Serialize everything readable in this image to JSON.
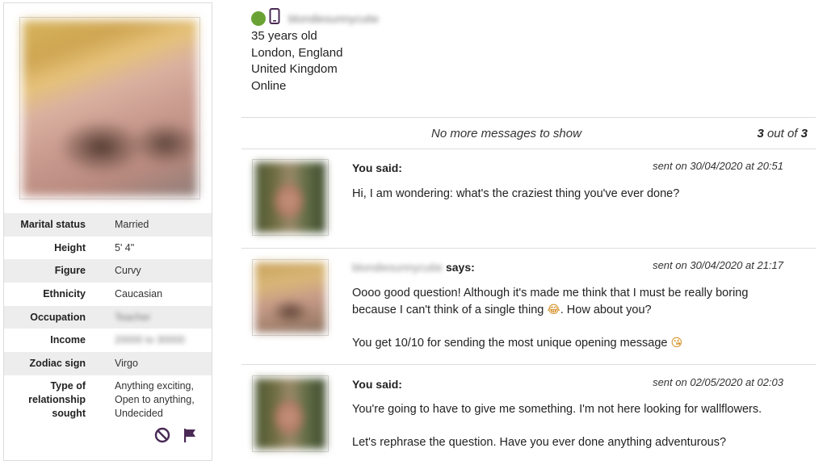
{
  "profile": {
    "username": "blondiesunnycutie",
    "age": "35 years old",
    "city": "London, England",
    "country": "United Kingdom",
    "status": "Online",
    "details": [
      {
        "label": "Marital status",
        "value": "Married"
      },
      {
        "label": "Height",
        "value": "5' 4\""
      },
      {
        "label": "Figure",
        "value": "Curvy"
      },
      {
        "label": "Ethnicity",
        "value": "Caucasian"
      },
      {
        "label": "Occupation",
        "value": "Teacher"
      },
      {
        "label": "Income",
        "value": "20000 to 30000"
      },
      {
        "label": "Zodiac sign",
        "value": "Virgo"
      }
    ],
    "relationship": {
      "label": "Type of relationship sought",
      "values": [
        "Anything exciting,",
        "Open to anything,",
        "Undecided"
      ]
    }
  },
  "banner": {
    "text": "No more messages to show",
    "count_current": "3",
    "count_sep": " out of ",
    "count_total": "3"
  },
  "messages": [
    {
      "author": "You said:",
      "time": "sent on 30/04/2020 at 20:51",
      "paragraphs": [
        "Hi, I am wondering: what's the craziest thing you've ever done?"
      ]
    },
    {
      "author_name": "blondiesunnycutie",
      "author_suffix": "says:",
      "time": "sent on 30/04/2020 at 21:17",
      "paragraphs": [
        "Oooo good question! Although it's made me think that I must be really boring",
        "because I can't think of a single thing",
        ". How about you?",
        "You get 10/10 for sending the most unique opening message"
      ]
    },
    {
      "author": "You said:",
      "time": "sent on 02/05/2020 at 02:03",
      "paragraphs": [
        "You're going to have to give me something. I'm not here looking for wallflowers.",
        "Let's rephrase the question. Have you ever done anything adventurous?"
      ]
    }
  ],
  "icons": {
    "status": "online-dot-icon",
    "device": "mobile-phone-icon",
    "block": "block-icon",
    "report": "flag-icon",
    "emoji_laugh": "laughing-emoji-icon",
    "emoji_wink": "winking-kiss-emoji-icon"
  },
  "colors": {
    "online": "#6aa334",
    "accent": "#4a2a55",
    "shaded_row": "#ededed"
  }
}
